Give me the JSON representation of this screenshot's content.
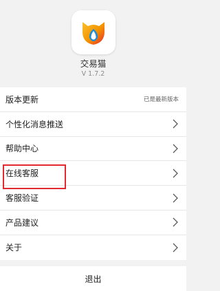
{
  "app": {
    "name": "交易猫",
    "version": "V 1.7.2"
  },
  "menu": {
    "items": [
      {
        "label": "版本更新",
        "value": "已是最新版本",
        "icon": "none"
      },
      {
        "label": "个性化消息推送",
        "icon": "chevron-right-icon"
      },
      {
        "label": "帮助中心",
        "icon": "chevron-right-icon"
      },
      {
        "label": "在线客服",
        "icon": "chevron-right-icon"
      },
      {
        "label": "客服验证",
        "icon": "chevron-right-icon",
        "highlighted": true
      },
      {
        "label": "产品建议",
        "icon": "chevron-right-icon"
      },
      {
        "label": "关于",
        "icon": "chevron-right-icon"
      }
    ]
  },
  "logout_label": "退出",
  "colors": {
    "background": "#f2f2f2",
    "highlight": "#e3282e",
    "logo_yellow": "#f7b21a",
    "logo_red": "#e8262c",
    "logo_blue": "#1a8ed8"
  }
}
